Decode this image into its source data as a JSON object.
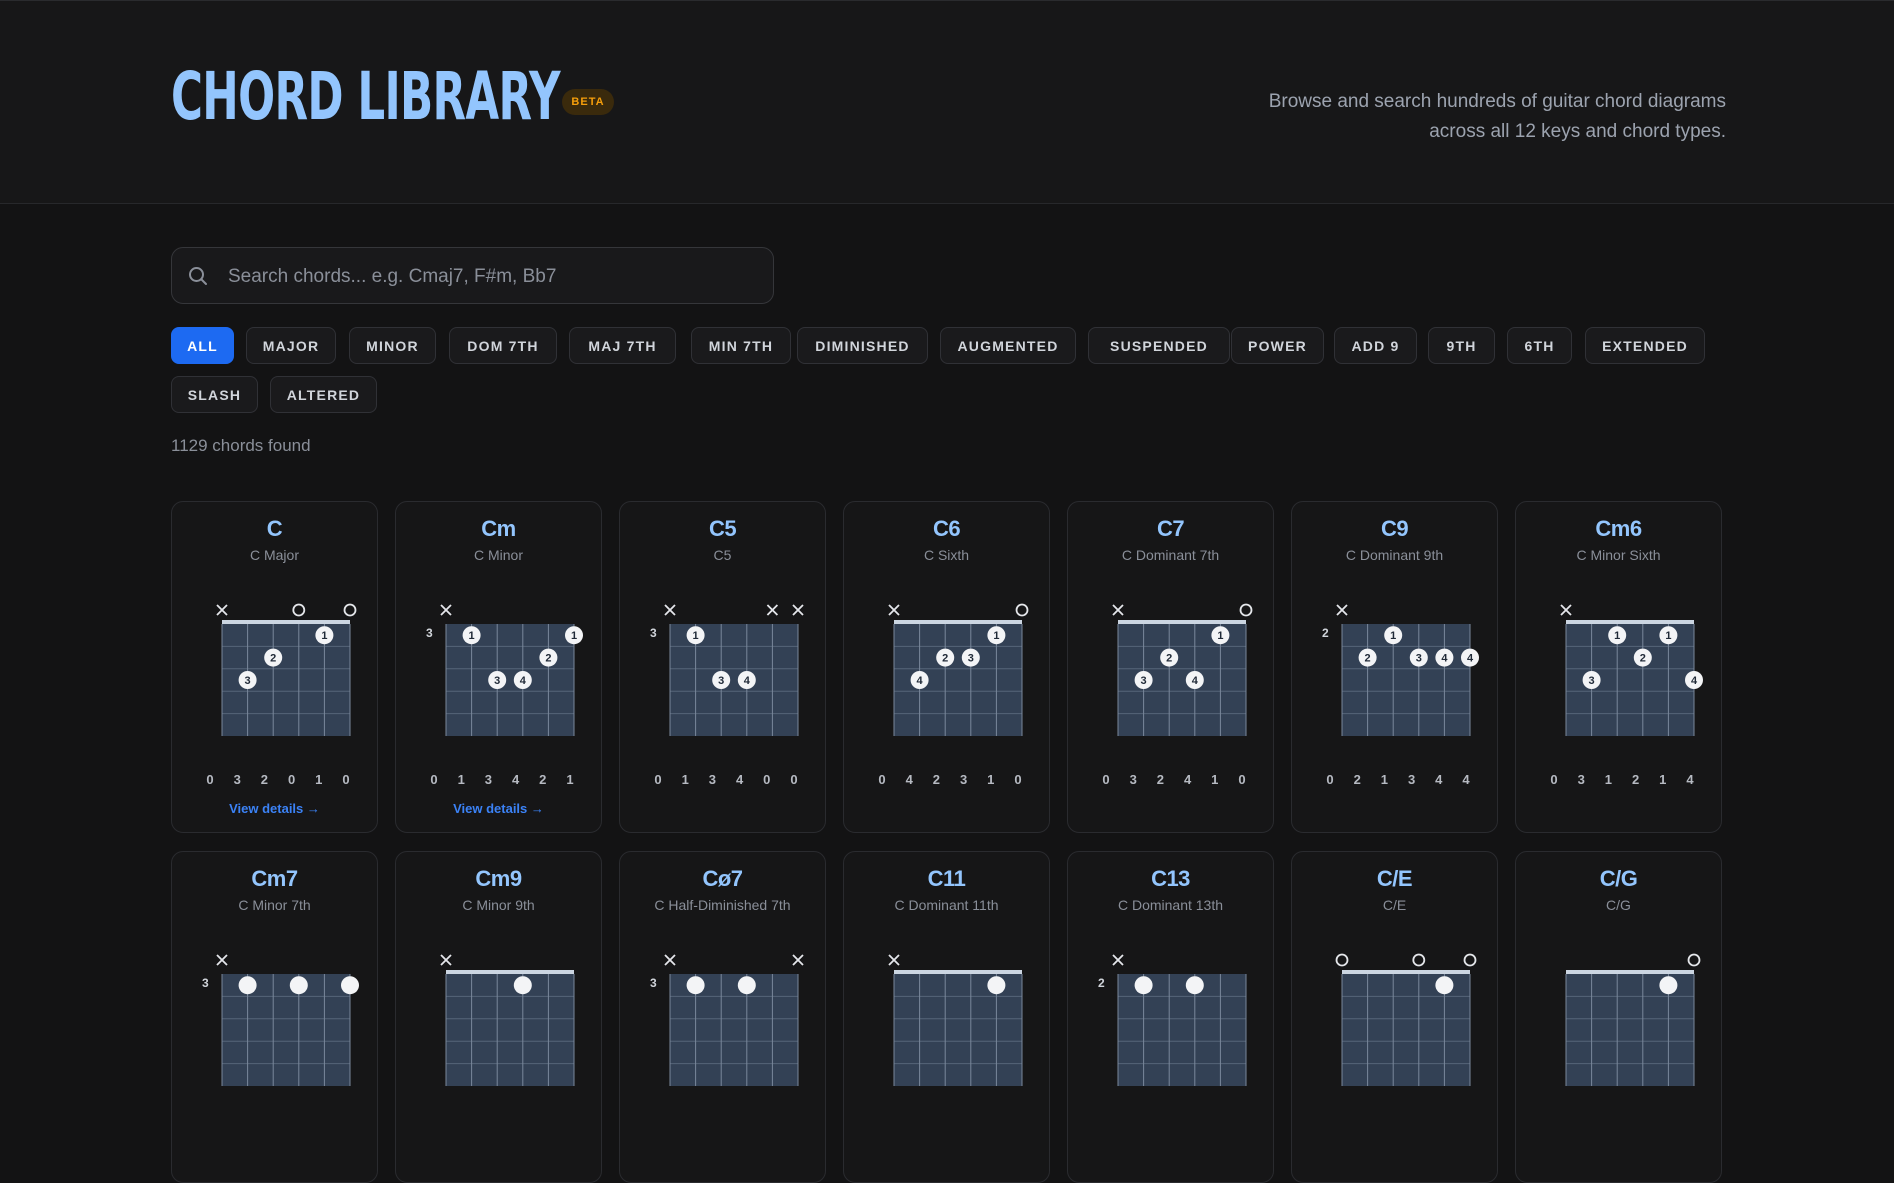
{
  "header": {
    "title": "CHORD LIBRARY",
    "badge": "BETA",
    "subtitle": "Browse and search hundreds of guitar chord diagrams across all 12 keys and chord types."
  },
  "search": {
    "placeholder": "Search chords... e.g. Cmaj7, F#m, Bb7",
    "value": ""
  },
  "filters": [
    "ALL",
    "MAJOR",
    "MINOR",
    "DOM 7TH",
    "MAJ 7TH",
    "MIN 7TH",
    "DIMINISHED",
    "AUGMENTED",
    "SUSPENDED",
    "POWER",
    "ADD 9",
    "9TH",
    "6TH",
    "EXTENDED",
    "SLASH",
    "ALTERED"
  ],
  "active_filter": "ALL",
  "result_count": "1129 chords found",
  "colors": {
    "accent": "#1d6af2",
    "chord_name": "#93c5fd",
    "badge": "#f59e0b",
    "fretboard": "#334155"
  },
  "view_details_label": "View details →",
  "chords": [
    {
      "name": "C",
      "full": "C Major",
      "frets": [
        "x",
        3,
        2,
        0,
        1,
        0
      ],
      "fingers": [
        "0",
        "3",
        "2",
        "0",
        "1",
        "0"
      ],
      "base_fret": 1,
      "details": true
    },
    {
      "name": "Cm",
      "full": "C Minor",
      "frets": [
        "x",
        3,
        5,
        5,
        4,
        3
      ],
      "fingers": [
        "0",
        "1",
        "3",
        "4",
        "2",
        "1"
      ],
      "base_fret": 3,
      "details": true
    },
    {
      "name": "C5",
      "full": "C5",
      "frets": [
        "x",
        3,
        5,
        5,
        "x",
        "x"
      ],
      "fingers": [
        "0",
        "1",
        "3",
        "4",
        "0",
        "0"
      ],
      "base_fret": 3,
      "details": false
    },
    {
      "name": "C6",
      "full": "C Sixth",
      "frets": [
        "x",
        3,
        2,
        2,
        1,
        0
      ],
      "fingers": [
        "0",
        "4",
        "2",
        "3",
        "1",
        "0"
      ],
      "base_fret": 1,
      "details": false
    },
    {
      "name": "C7",
      "full": "C Dominant 7th",
      "frets": [
        "x",
        3,
        2,
        3,
        1,
        0
      ],
      "fingers": [
        "0",
        "3",
        "2",
        "4",
        "1",
        "0"
      ],
      "base_fret": 1,
      "details": false
    },
    {
      "name": "C9",
      "full": "C Dominant 9th",
      "frets": [
        "x",
        3,
        2,
        3,
        3,
        3
      ],
      "fingers": [
        "0",
        "2",
        "1",
        "3",
        "4",
        "4"
      ],
      "base_fret": 2,
      "details": false
    },
    {
      "name": "Cm6",
      "full": "C Minor Sixth",
      "frets": [
        "x",
        3,
        1,
        2,
        1,
        3
      ],
      "fingers": [
        "0",
        "3",
        "1",
        "2",
        "1",
        "4"
      ],
      "base_fret": 1,
      "details": false
    },
    {
      "name": "Cm7",
      "full": "C Minor 7th",
      "frets": [
        "x",
        3,
        "",
        3,
        "",
        3
      ],
      "fingers": [],
      "base_fret": 3,
      "details": false
    },
    {
      "name": "Cm9",
      "full": "C Minor 9th",
      "frets": [
        "x",
        "",
        "",
        1,
        "",
        ""
      ],
      "fingers": [],
      "base_fret": 1,
      "details": false
    },
    {
      "name": "Cø7",
      "full": "C Half-Diminished 7th",
      "frets": [
        "x",
        3,
        "",
        3,
        "",
        "x"
      ],
      "fingers": [],
      "base_fret": 3,
      "details": false
    },
    {
      "name": "C11",
      "full": "C Dominant 11th",
      "frets": [
        "x",
        "",
        "",
        "",
        1,
        ""
      ],
      "fingers": [],
      "base_fret": 1,
      "details": false
    },
    {
      "name": "C13",
      "full": "C Dominant 13th",
      "frets": [
        "x",
        2,
        "",
        2,
        "",
        ""
      ],
      "fingers": [],
      "base_fret": 2,
      "details": false
    },
    {
      "name": "C/E",
      "full": "C/E",
      "frets": [
        0,
        "",
        "",
        0,
        1,
        0
      ],
      "fingers": [],
      "base_fret": 1,
      "details": false
    },
    {
      "name": "C/G",
      "full": "C/G",
      "frets": [
        "",
        "",
        "",
        "",
        1,
        0
      ],
      "fingers": [],
      "base_fret": 1,
      "details": false
    }
  ]
}
